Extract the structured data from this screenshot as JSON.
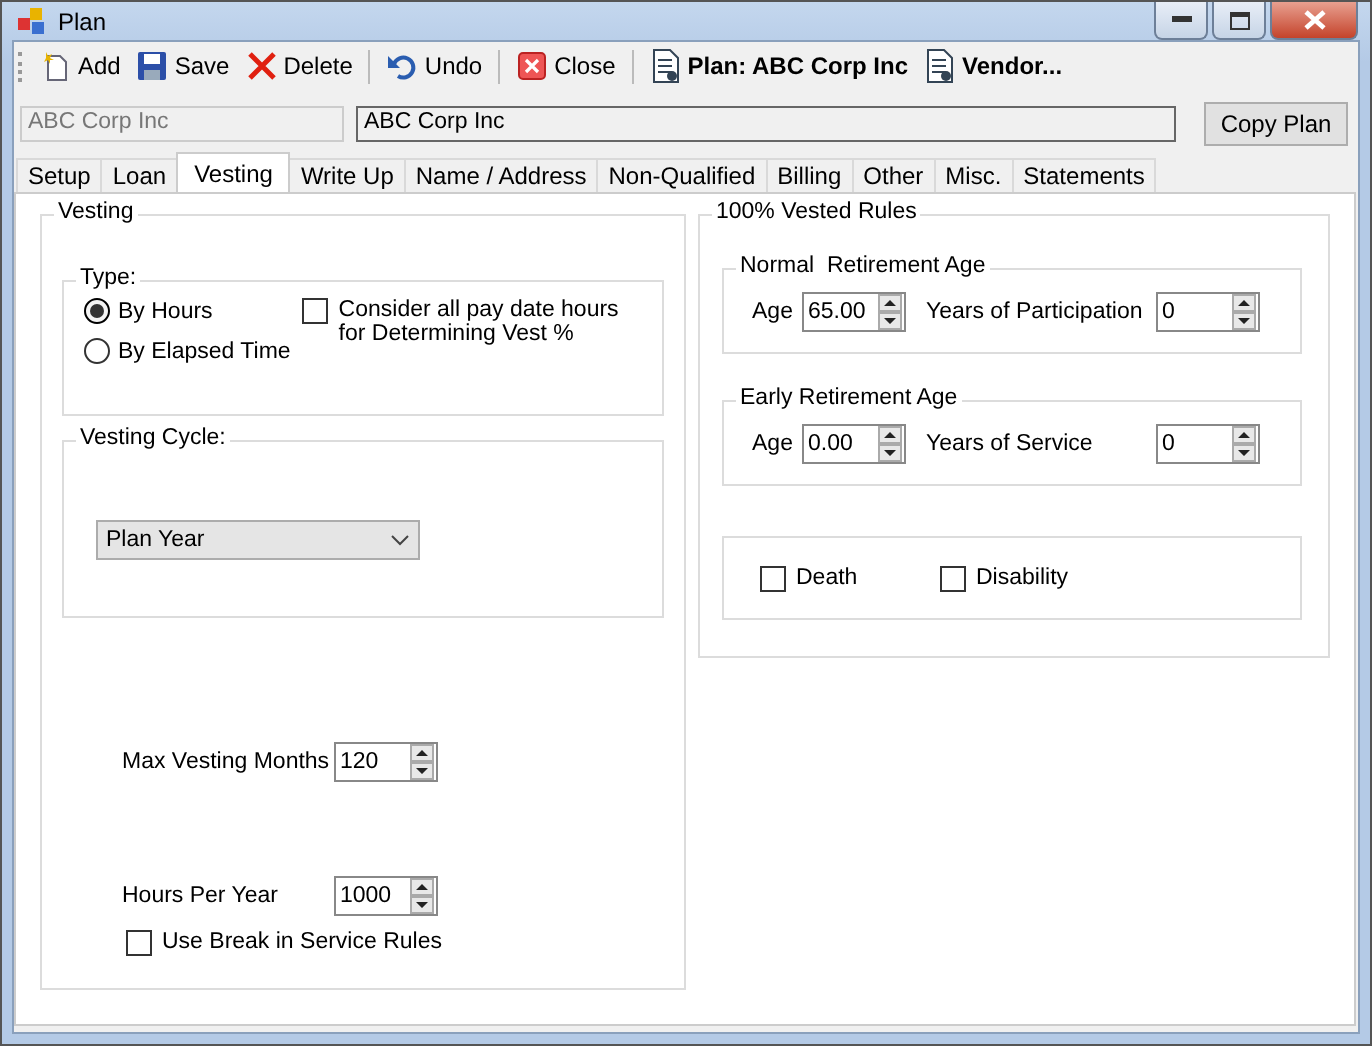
{
  "window": {
    "title": "Plan"
  },
  "toolbar": [
    {
      "kind": "add",
      "label": "Add"
    },
    {
      "kind": "save",
      "label": "Save"
    },
    {
      "kind": "delete",
      "label": "Delete"
    },
    {
      "kind": "undo",
      "label": "Undo"
    },
    {
      "kind": "close",
      "label": "Close"
    },
    {
      "kind": "document",
      "label": "Plan: ABC Corp Inc"
    },
    {
      "kind": "document",
      "label": "Vendor..."
    }
  ],
  "header": {
    "code": {
      "value": "ABC Corp Inc",
      "disabled": true
    },
    "name": {
      "value": "ABC Corp Inc",
      "disabled": false
    },
    "button": "Copy Plan"
  },
  "tabs": [
    {
      "label": "Setup",
      "selected": false
    },
    {
      "label": "Loan",
      "selected": false
    },
    {
      "label": "Vesting",
      "selected": true
    },
    {
      "label": "Write Up",
      "selected": false
    },
    {
      "label": "Name / Address",
      "selected": false
    },
    {
      "label": "Non-Qualified",
      "selected": false
    },
    {
      "label": "Billing",
      "selected": false
    },
    {
      "label": "Other",
      "selected": false
    },
    {
      "label": "Misc.",
      "selected": false
    },
    {
      "label": "Statements",
      "selected": false
    }
  ],
  "vesting": {
    "title": "Vesting",
    "type": {
      "title": "Type:",
      "options": [
        {
          "label": "By Hours",
          "selected": true
        },
        {
          "label": "By Elapsed Time",
          "selected": false
        }
      ],
      "consider": {
        "label": "Consider all pay date hours for Determining Vest %",
        "checked": false
      }
    },
    "cycle": {
      "title": "Vesting Cycle:",
      "value": "Plan Year"
    },
    "max_vesting_months": {
      "label": "Max Vesting Months",
      "value": "120"
    },
    "hours_per_year": {
      "label": "Hours Per Year",
      "value": "1000"
    },
    "break_in_service": {
      "label": "Use Break in Service Rules",
      "checked": false
    }
  },
  "vested_rules": {
    "title": "100% Vested Rules",
    "groups": [
      {
        "title": "Normal  Retirement Age",
        "age_label": "Age",
        "age": "65.00",
        "years_label": "Years of Participation",
        "years": "0"
      },
      {
        "title": "Early Retirement Age",
        "age_label": "Age",
        "age": "0.00",
        "years_label": "Years of Service",
        "years": "0"
      }
    ],
    "options": [
      {
        "label": "Death",
        "checked": false
      },
      {
        "label": "Disability",
        "checked": false
      }
    ]
  }
}
